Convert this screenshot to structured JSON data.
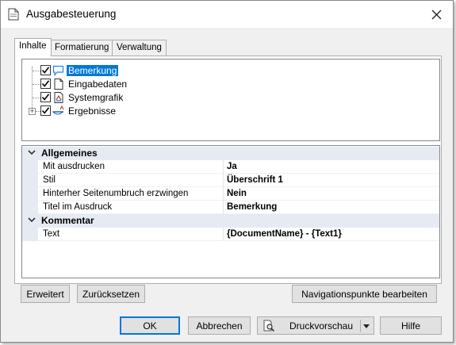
{
  "window": {
    "title": "Ausgabesteuerung",
    "icon": "document-icon",
    "close_icon": "close-icon"
  },
  "tabs": [
    {
      "label": "Inhalte",
      "active": true
    },
    {
      "label": "Formatierung",
      "active": false
    },
    {
      "label": "Verwaltung",
      "active": false
    }
  ],
  "tree": {
    "items": [
      {
        "label": "Bemerkung",
        "checked": true,
        "icon": "comment-icon",
        "selected": true
      },
      {
        "label": "Eingabedaten",
        "checked": true,
        "icon": "page-icon",
        "selected": false
      },
      {
        "label": "Systemgrafik",
        "checked": true,
        "icon": "graphic-icon",
        "selected": false
      },
      {
        "label": "Ergebnisse",
        "checked": true,
        "icon": "results-icon",
        "selected": false,
        "expandable": true,
        "expander": "+"
      }
    ]
  },
  "grid": {
    "categories": [
      {
        "label": "Allgemeines",
        "properties": [
          {
            "name": "Mit ausdrucken",
            "value": "Ja"
          },
          {
            "name": "Stil",
            "value": "Überschrift 1"
          },
          {
            "name": "Hinterher Seitenumbruch erzwingen",
            "value": "Nein"
          },
          {
            "name": "Titel im Ausdruck",
            "value": "Bemerkung"
          }
        ]
      },
      {
        "label": "Kommentar",
        "properties": [
          {
            "name": "Text",
            "value": "{DocumentName} - {Text1}"
          }
        ]
      }
    ]
  },
  "panel_buttons": {
    "advanced": "Erweitert",
    "reset": "Zurücksetzen",
    "nav_points": "Navigationspunkte bearbeiten"
  },
  "footer": {
    "ok": "OK",
    "cancel": "Abbrechen",
    "print_preview": "Druckvorschau",
    "print_preview_icon": "magnifier-icon",
    "dropdown_icon": "dropdown-arrow-icon",
    "help": "Hilfe"
  },
  "colors": {
    "selection": "#0078d7",
    "category_bg": "#e6ebf3",
    "dialog_bg": "#f0f0f0"
  }
}
